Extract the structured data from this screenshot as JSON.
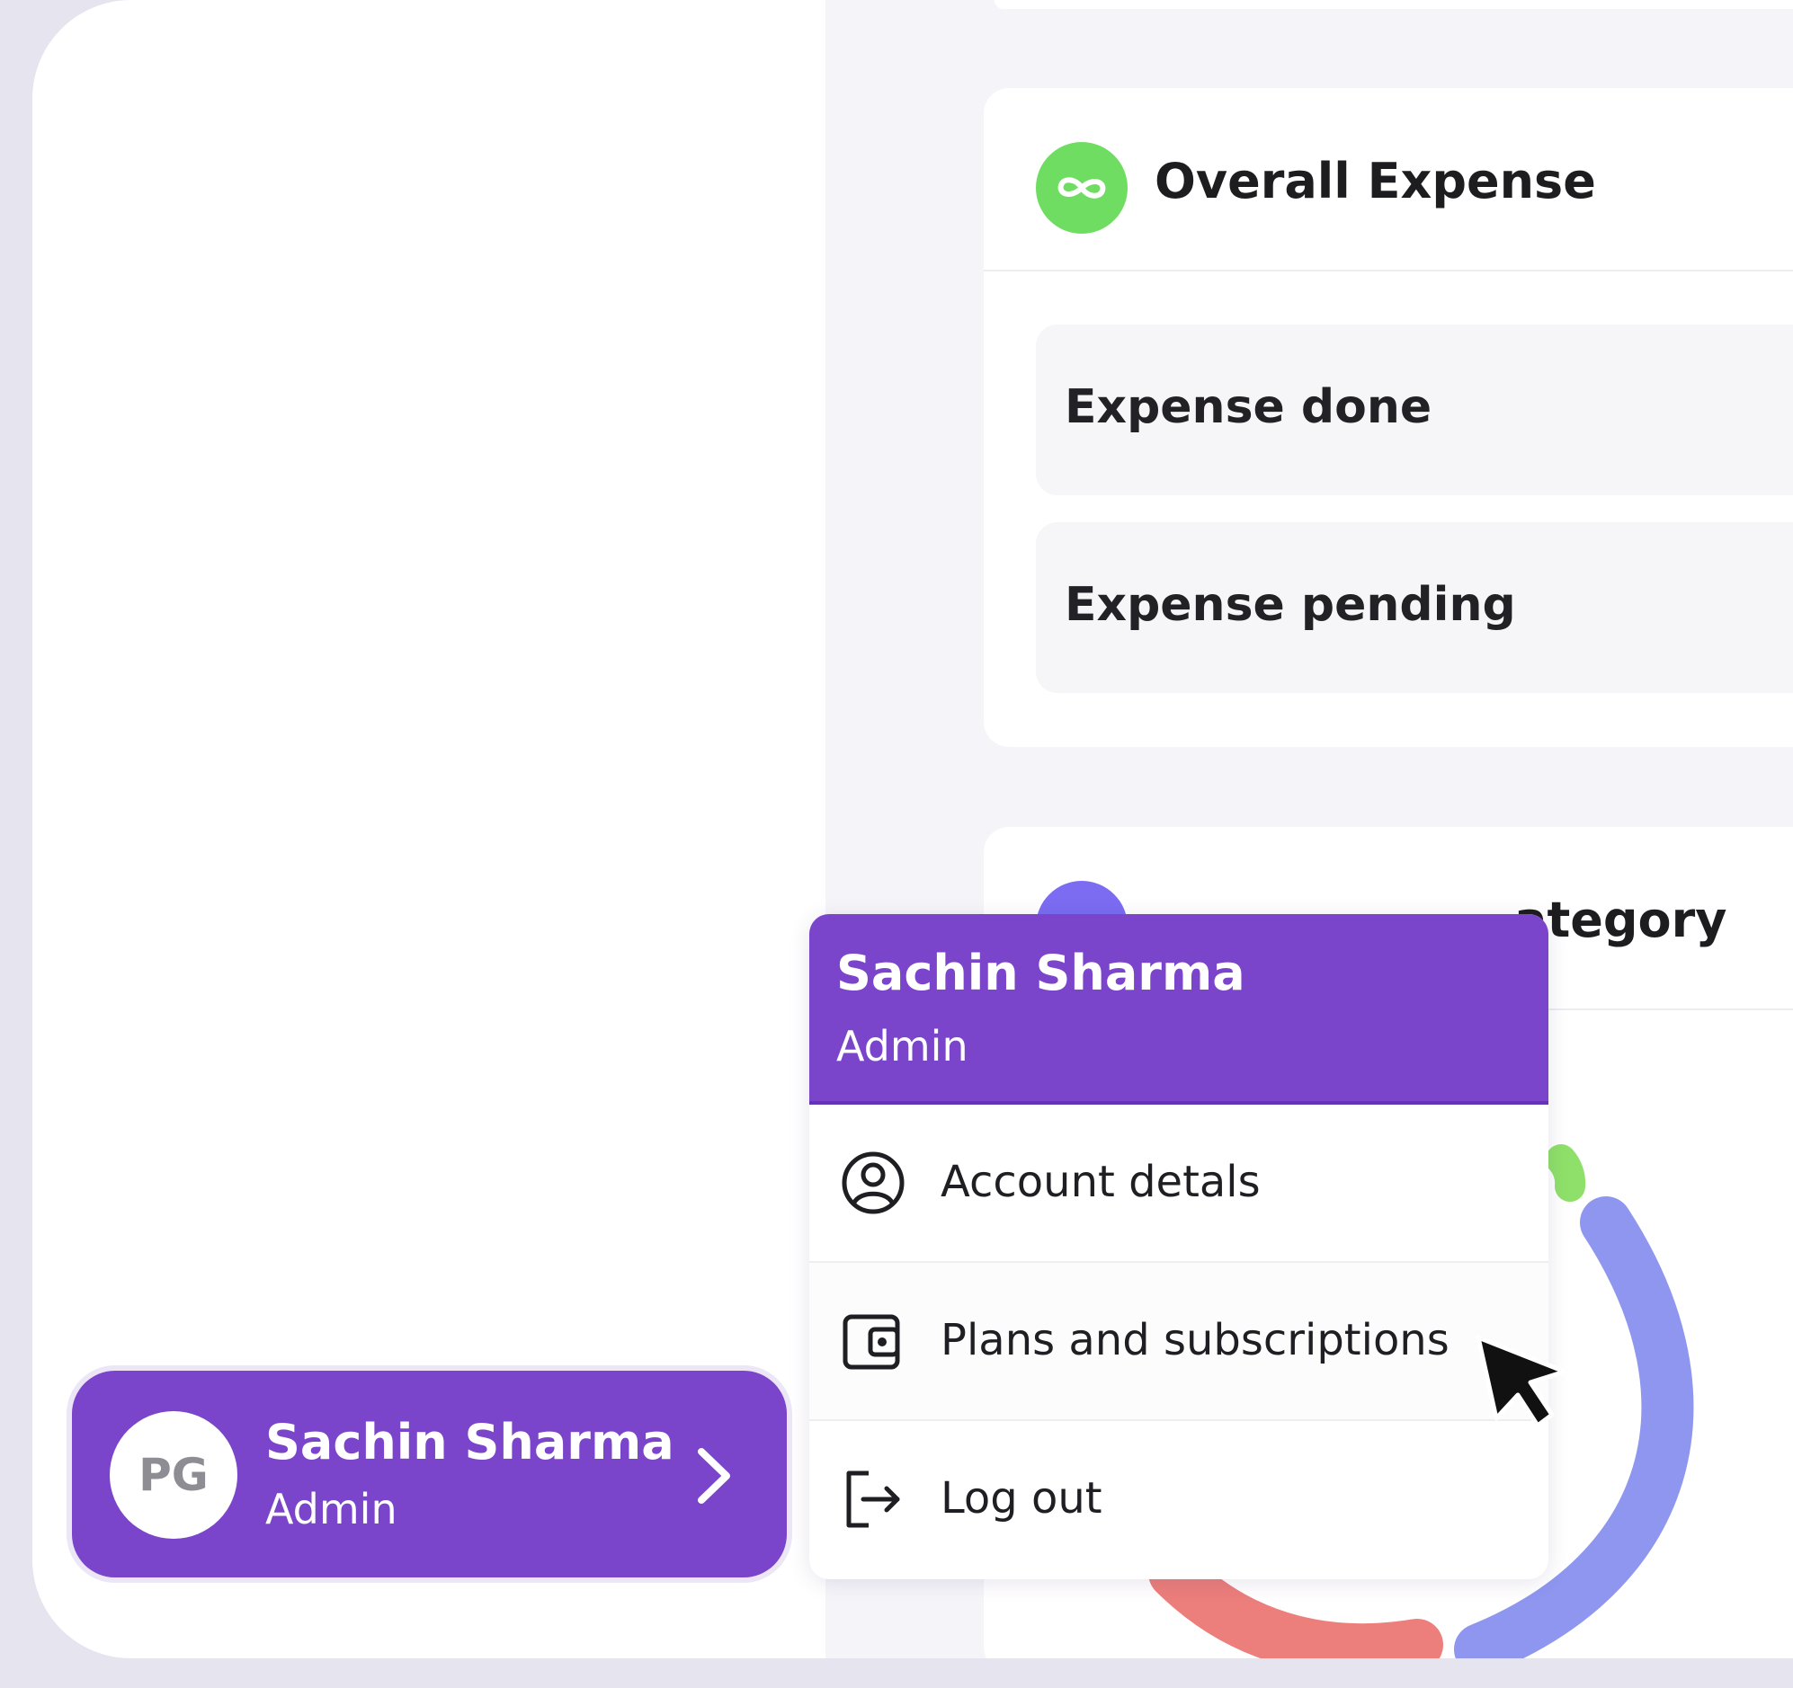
{
  "overall_expense": {
    "title": "Overall Expense",
    "icon": "infinity-icon",
    "rows": [
      {
        "label": "Expense done"
      },
      {
        "label": "Expense pending"
      }
    ]
  },
  "category_card": {
    "title_visible_fragment": "ategory",
    "icon": "category-icon"
  },
  "profile_button": {
    "initials": "PG",
    "name": "Sachin Sharma",
    "role": "Admin"
  },
  "dropdown": {
    "name": "Sachin Sharma",
    "role": "Admin",
    "items": [
      {
        "label": "Account detals",
        "icon": "user-circle-icon"
      },
      {
        "label": "Plans and subscriptions",
        "icon": "wallet-icon"
      },
      {
        "label": "Log out",
        "icon": "logout-icon"
      }
    ]
  },
  "colors": {
    "accent_purple": "#7a45ca",
    "green_icon": "#6fdc62",
    "donut_blue": "#8e96ef",
    "donut_red": "#ec7e7b",
    "donut_green": "#8fe06a"
  }
}
